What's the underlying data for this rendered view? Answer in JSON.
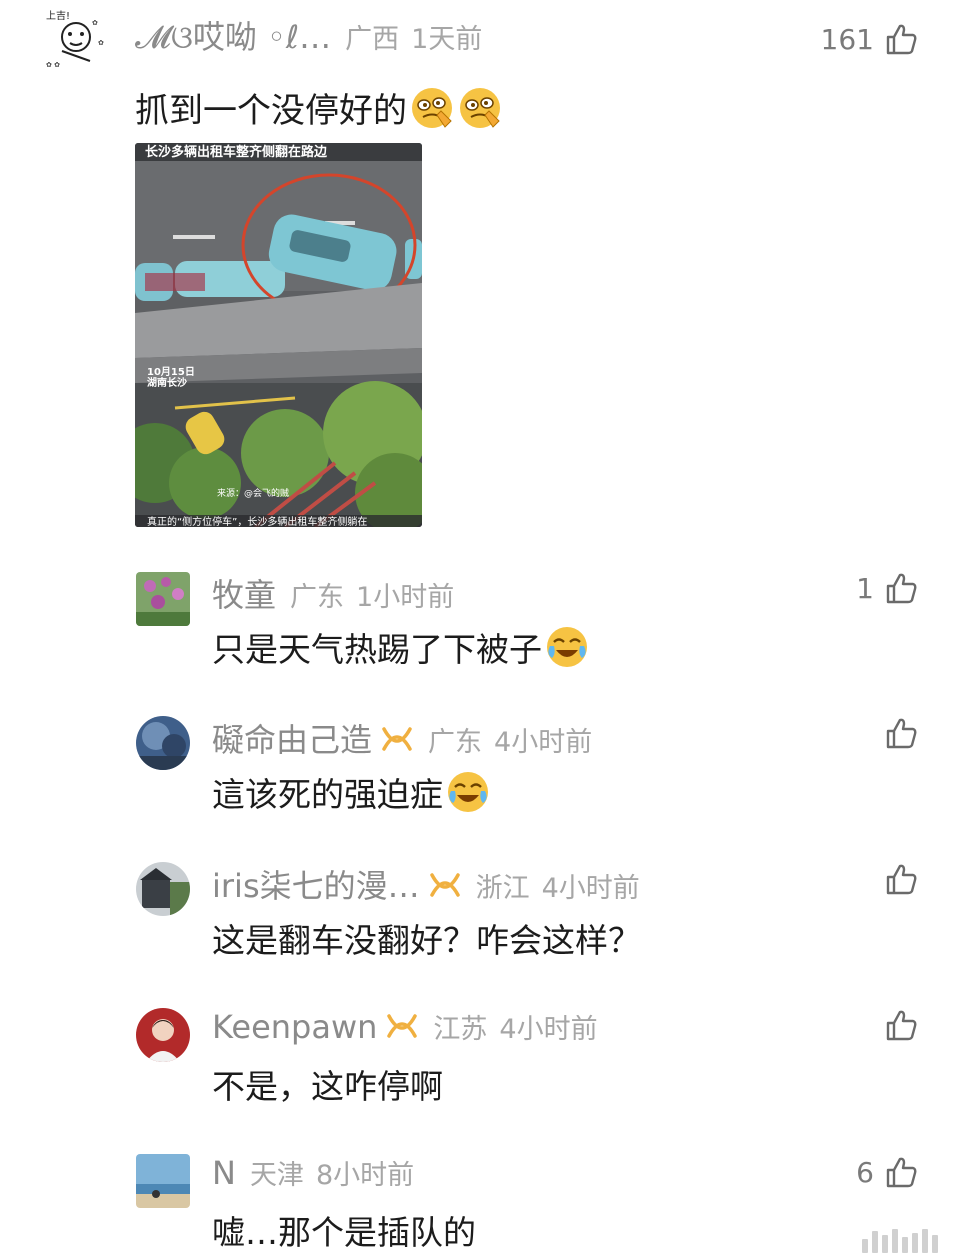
{
  "post": {
    "user": {
      "name": "𝓜ଓ哎呦 ◦ℓ…",
      "region": "广西",
      "time": "1天前"
    },
    "likes": "161",
    "text": "抓到一个没停好的",
    "emojis": [
      "wince-emoji",
      "wince-emoji"
    ],
    "image": {
      "caption_top": "长沙多辆出租车整齐侧翻在路边",
      "date_stamp_1": "10月15日",
      "date_stamp_2": "湖南长沙",
      "source": "来源：@会飞的贼",
      "subtitle": "真正的“侧方位停车”，长沙多辆出租车整齐侧躺在"
    }
  },
  "replies": [
    {
      "name": "牧童",
      "region": "广东",
      "time": "1小时前",
      "likes": "1",
      "text": "只是天气热踢了下被子",
      "emoji": "laugh-cry-emoji",
      "badge": false,
      "avatar": "flowers-avatar"
    },
    {
      "name": "礙命由己造",
      "region": "广东",
      "time": "4小时前",
      "likes": "",
      "text": "這该死的强迫症",
      "emoji": "laugh-cry-emoji",
      "badge": true,
      "avatar": "sky-avatar"
    },
    {
      "name": "iris柒七的漫…",
      "region": "浙江",
      "time": "4小时前",
      "likes": "",
      "text": "这是翻车没翻好？咋会这样？",
      "emoji": "",
      "badge": true,
      "avatar": "house-avatar"
    },
    {
      "name": "Keenpawn",
      "region": "江苏",
      "time": "4小时前",
      "likes": "",
      "text": "不是，这咋停啊",
      "emoji": "",
      "badge": true,
      "avatar": "person-avatar"
    },
    {
      "name": "N",
      "region": "天津",
      "time": "8小时前",
      "likes": "6",
      "text": "嘘…那个是插队的",
      "emoji": "",
      "badge": false,
      "avatar": "beach-avatar"
    }
  ],
  "colors": {
    "name": "#8a8a8a",
    "meta": "#a6a6a6",
    "text": "#1c1c1c",
    "badge": "#f0b040"
  }
}
